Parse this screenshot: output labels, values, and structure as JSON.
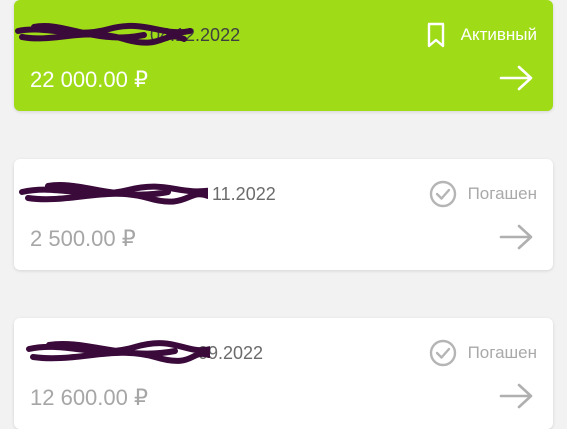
{
  "loans": [
    {
      "date_suffix": "04.12.2022",
      "status": "Активный",
      "status_icon": "bookmark-icon",
      "amount": "22 000.00 ₽",
      "active": true
    },
    {
      "date_suffix": "11.2022",
      "status": "Погашен",
      "status_icon": "check-circle-icon",
      "amount": "2 500.00 ₽",
      "active": false
    },
    {
      "date_suffix": "09.2022",
      "status": "Погашен",
      "status_icon": "check-circle-icon",
      "amount": "12 600.00 ₽",
      "active": false
    }
  ],
  "colors": {
    "active_card": "#9fdc17",
    "paid_text": "#a6a6a6",
    "scribble": "#3a0a3a"
  }
}
